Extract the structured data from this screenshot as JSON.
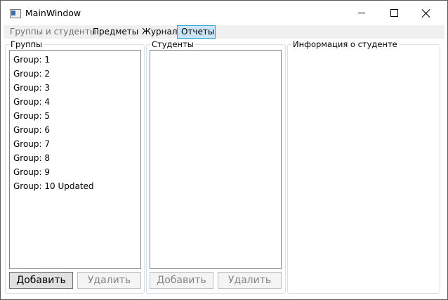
{
  "window": {
    "title": "MainWindow"
  },
  "menu": {
    "items": [
      {
        "label": "Группы и студенты"
      },
      {
        "label": "Предметы"
      },
      {
        "label": "Журнал"
      },
      {
        "label": "Отчеты"
      }
    ]
  },
  "groups_panel": {
    "title": "Группы",
    "items": [
      "Group: 1",
      "Group: 2",
      "Group: 3",
      "Group: 4",
      "Group: 5",
      "Group: 6",
      "Group: 7",
      "Group: 8",
      "Group: 9",
      "Group: 10 Updated"
    ],
    "add_label": "Добавить",
    "delete_label": "Удалить"
  },
  "students_panel": {
    "title": "Студенты",
    "items": [],
    "add_label": "Добавить",
    "delete_label": "Удалить"
  },
  "info_panel": {
    "title": "Информация о студенте"
  }
}
